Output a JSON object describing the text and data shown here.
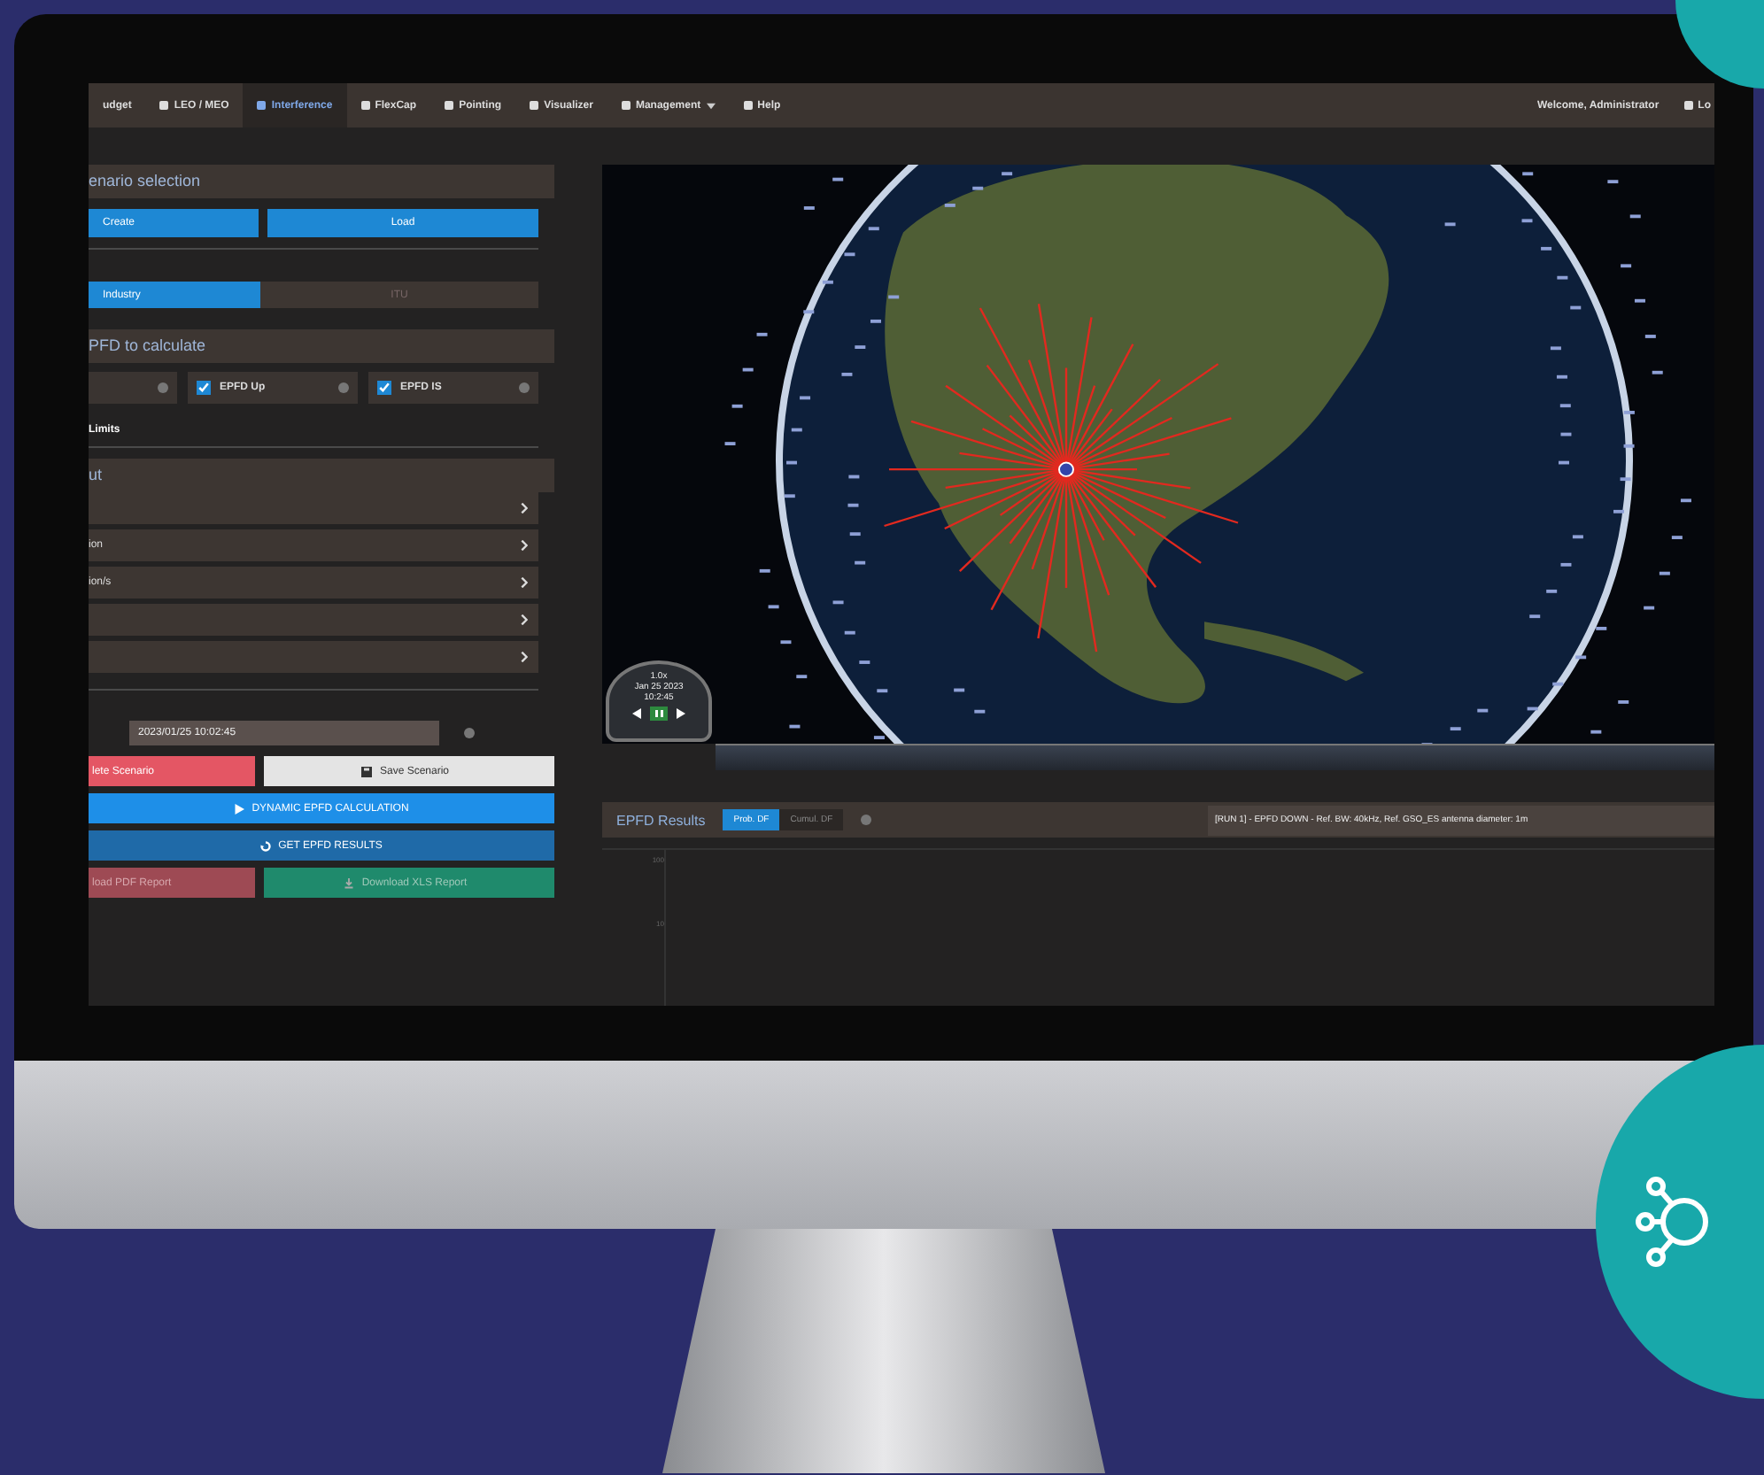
{
  "navbar": {
    "items": [
      {
        "label": "udget",
        "selected": false,
        "dropdown": false
      },
      {
        "label": "LEO / MEO",
        "selected": false,
        "dropdown": false
      },
      {
        "label": "Interference",
        "selected": true,
        "dropdown": false
      },
      {
        "label": "FlexCap",
        "selected": false,
        "dropdown": false
      },
      {
        "label": "Pointing",
        "selected": false,
        "dropdown": false
      },
      {
        "label": "Visualizer",
        "selected": false,
        "dropdown": false
      },
      {
        "label": "Management",
        "selected": false,
        "dropdown": true
      },
      {
        "label": "Help",
        "selected": false,
        "dropdown": false
      }
    ],
    "welcome": "Welcome, Administrator",
    "logout": "Lo"
  },
  "sidebar": {
    "scenario_header": "enario selection",
    "scenario_buttons": [
      "Create",
      "Load"
    ],
    "mode_toggle": [
      {
        "label": "Industry",
        "selected": true
      },
      {
        "label": "ITU",
        "selected": false
      }
    ],
    "calc_header": "PFD to calculate",
    "checks": [
      {
        "label": "EPFD Up",
        "checked": true
      },
      {
        "label": "EPFD IS",
        "checked": true
      }
    ],
    "limits_label": "Limits",
    "input_header": "ut",
    "input_rows": [
      null,
      "ion",
      "ion/s",
      null,
      null
    ],
    "date_field": "2023/01/25 10:02:45",
    "actions": [
      {
        "kind": "delete",
        "label": "lete Scenario"
      },
      {
        "kind": "save",
        "label": "Save Scenario"
      },
      {
        "kind": "run",
        "label": "DYNAMIC EPFD CALCULATION"
      },
      {
        "kind": "results",
        "label": "GET EPFD RESULTS"
      },
      {
        "kind": "pdf",
        "label": "load PDF Report"
      },
      {
        "kind": "xls",
        "label": "Download XLS Report"
      }
    ]
  },
  "map": {
    "clock": {
      "speed": "1.0x",
      "date": "Jan 25 2023",
      "time": "10:2:45"
    }
  },
  "results": {
    "title": "EPFD Results",
    "tabs": [
      {
        "label": "Prob. DF",
        "selected": true
      },
      {
        "label": "Cumul. DF",
        "selected": false
      }
    ],
    "run_select": "[RUN 1] - EPFD DOWN - Ref. BW: 40kHz, Ref. GSO_ES antenna diameter: 1m",
    "y_labels": [
      "100",
      "10"
    ]
  }
}
